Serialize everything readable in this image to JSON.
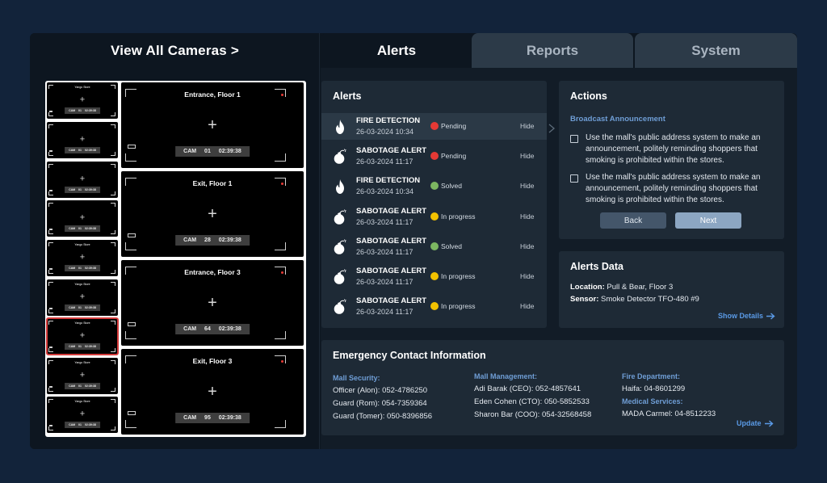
{
  "left": {
    "view_all": "View All Cameras >",
    "big_cams": [
      {
        "title": "Entrance, Floor 1",
        "cam": "CAM 01",
        "time": "02:39:38"
      },
      {
        "title": "Exit, Floor 1",
        "cam": "CAM 28",
        "time": "02:39:38"
      },
      {
        "title": "Entrance, Floor 3",
        "cam": "CAM 64",
        "time": "02:39:38"
      },
      {
        "title": "Exit, Floor 3",
        "cam": "CAM 95",
        "time": "02:39:38"
      }
    ],
    "small_cams": [
      {
        "title": "Yango Store",
        "cam": "CAM 01",
        "time": "02:39:38"
      },
      {
        "title": "",
        "cam": "CAM 01",
        "time": "02:39:38"
      },
      {
        "title": "",
        "cam": "CAM 01",
        "time": "02:39:38"
      },
      {
        "title": "",
        "cam": "CAM 01",
        "time": "02:39:38"
      },
      {
        "title": "Yango Store",
        "cam": "CAM 01",
        "time": "02:39:38"
      },
      {
        "title": "Yango Store",
        "cam": "CAM 01",
        "time": "02:39:38"
      },
      {
        "title": "Yango Store",
        "cam": "CAM 01",
        "time": "02:39:38"
      },
      {
        "title": "Yango Store",
        "cam": "CAM 01",
        "time": "02:39:38"
      },
      {
        "title": "Yango Store",
        "cam": "CAM 01",
        "time": "02:39:38"
      }
    ]
  },
  "tabs": {
    "alerts": "Alerts",
    "reports": "Reports",
    "system": "System"
  },
  "alerts": {
    "title": "Alerts",
    "hide_label": "Hide",
    "items": [
      {
        "name": "FIRE DETECTION",
        "date": "26-03-2024 10:34",
        "status": "Pending",
        "type": "fire",
        "status_color": "#e53935"
      },
      {
        "name": "SABOTAGE ALERT",
        "date": "26-03-2024 11:17",
        "status": "Pending",
        "type": "bomb",
        "status_color": "#e53935"
      },
      {
        "name": "FIRE DETECTION",
        "date": "26-03-2024 10:34",
        "status": "Solved",
        "type": "fire",
        "status_color": "#7cb661"
      },
      {
        "name": "SABOTAGE ALERT",
        "date": "26-03-2024 11:17",
        "status": "In progress",
        "type": "bomb",
        "status_color": "#f2c100"
      },
      {
        "name": "SABOTAGE ALERT",
        "date": "26-03-2024 11:17",
        "status": "Solved",
        "type": "bomb",
        "status_color": "#7cb661"
      },
      {
        "name": "SABOTAGE ALERT",
        "date": "26-03-2024 11:17",
        "status": "In progress",
        "type": "bomb",
        "status_color": "#f2c100"
      },
      {
        "name": "SABOTAGE ALERT",
        "date": "26-03-2024 11:17",
        "status": "In progress",
        "type": "bomb",
        "status_color": "#f2c100"
      }
    ]
  },
  "actions": {
    "title": "Actions",
    "subheading": "Broadcast Announcement",
    "options": [
      "Use the mall's public address system to make an announcement, politely reminding shoppers that smoking is prohibited within the stores.",
      "Use the mall's public address system to make an announcement, politely reminding shoppers that smoking is prohibited within the stores."
    ],
    "back": "Back",
    "next": "Next"
  },
  "alerts_data": {
    "title": "Alerts Data",
    "location_label": "Location:",
    "location_value": "Pull & Bear, Floor 3",
    "sensor_label": "Sensor:",
    "sensor_value": "Smoke Detector TFO-480 #9",
    "show_details": "Show Details"
  },
  "emergency": {
    "title": "Emergency Contact Information",
    "security": {
      "heading": "Mall Security:",
      "lines": [
        "Officer (Alon): 052-4786250",
        "Guard (Rom): 054-7359364",
        "Guard (Tomer): 050-8396856"
      ]
    },
    "management": {
      "heading": "Mall Management:",
      "lines": [
        "Adi Barak (CEO): 052-4857641",
        "Eden Cohen (CTO): 050-5852533",
        "Sharon Bar (COO): 054-32568458"
      ]
    },
    "fire": {
      "heading": "Fire Department:",
      "lines": [
        "Haifa: 04-8601299"
      ]
    },
    "medical": {
      "heading": "Medical Services:",
      "lines": [
        "MADA Carmel: 04-8512233"
      ]
    },
    "update": "Update"
  },
  "colors": {
    "accent_link": "#5a9ae6",
    "subheading": "#6f9ed6",
    "selected_cam": "#d33a3a"
  }
}
